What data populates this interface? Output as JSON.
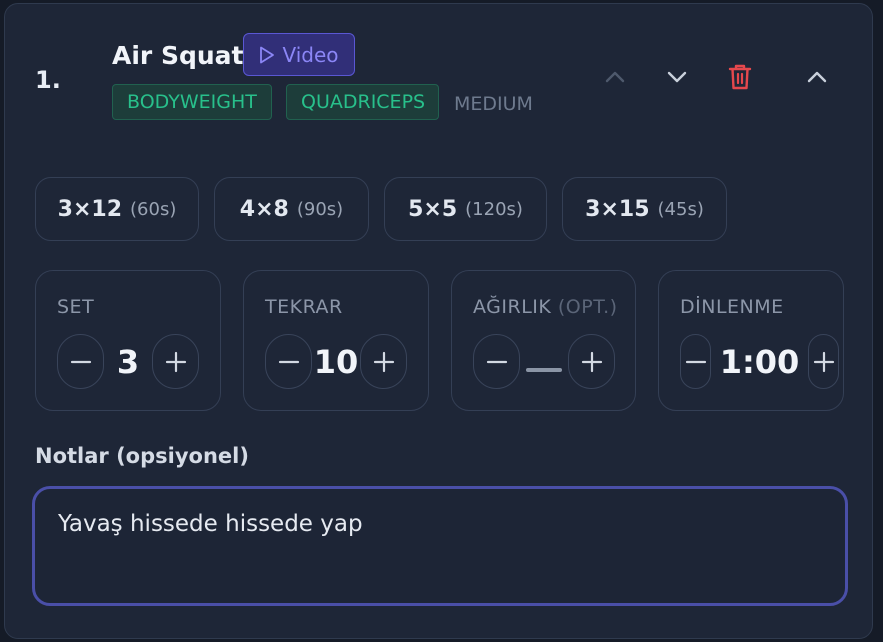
{
  "exercise": {
    "index": "1.",
    "name": "Air Squat",
    "video_label": "Video",
    "tags": [
      "BODYWEIGHT",
      "QUADRICEPS"
    ],
    "difficulty": "MEDIUM"
  },
  "presets": [
    {
      "sets": "3×12",
      "rest": "(60s)"
    },
    {
      "sets": "4×8",
      "rest": "(90s)"
    },
    {
      "sets": "5×5",
      "rest": "(120s)"
    },
    {
      "sets": "3×15",
      "rest": "(45s)"
    }
  ],
  "stats": {
    "set": {
      "label": "SET",
      "value": "3"
    },
    "reps": {
      "label": "TEKRAR",
      "value": "10"
    },
    "weight": {
      "label": "AĞIRLIK",
      "optional": "(OPT.)",
      "value": "—"
    },
    "rest": {
      "label": "DİNLENME",
      "value": "1:00"
    }
  },
  "notes": {
    "label": "Notlar (opsiyonel)",
    "value": "Yavaş hissede hissede yap"
  },
  "icons": {
    "video": "play-icon",
    "move_up": "chevron-up-icon",
    "move_down": "chevron-down-icon",
    "delete": "trash-icon",
    "collapse": "chevron-up-icon",
    "decrement": "minus-icon",
    "increment": "plus-icon"
  },
  "colors": {
    "accent": "#5a57d3",
    "tag_green": "#28c08b",
    "danger": "#e5484d"
  }
}
